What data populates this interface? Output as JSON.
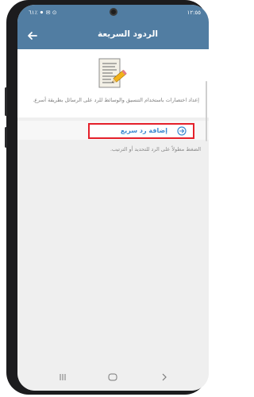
{
  "status_bar": {
    "left_text": "١٢:٥٥",
    "right_text": "٦١٪ ⚫ ✉ ⊙",
    "icons": [
      "battery-icon",
      "signal-icon",
      "wifi-icon",
      "message-icon",
      "record-icon"
    ]
  },
  "header": {
    "title": "الردود السريعة"
  },
  "intro": {
    "description": "إعداد اختصارات باستخدام التنسيق والوسائط للرد على الرسائل بطريقة أسرع."
  },
  "add_button": {
    "label": "إضافة رد سريع"
  },
  "hint": {
    "text": "الضغط مطولاً على الرد للتحديد أو الترتيب."
  },
  "colors": {
    "header_blue": "#517da2",
    "accent_blue": "#3c8ad1",
    "highlight_red": "#e5202a"
  }
}
